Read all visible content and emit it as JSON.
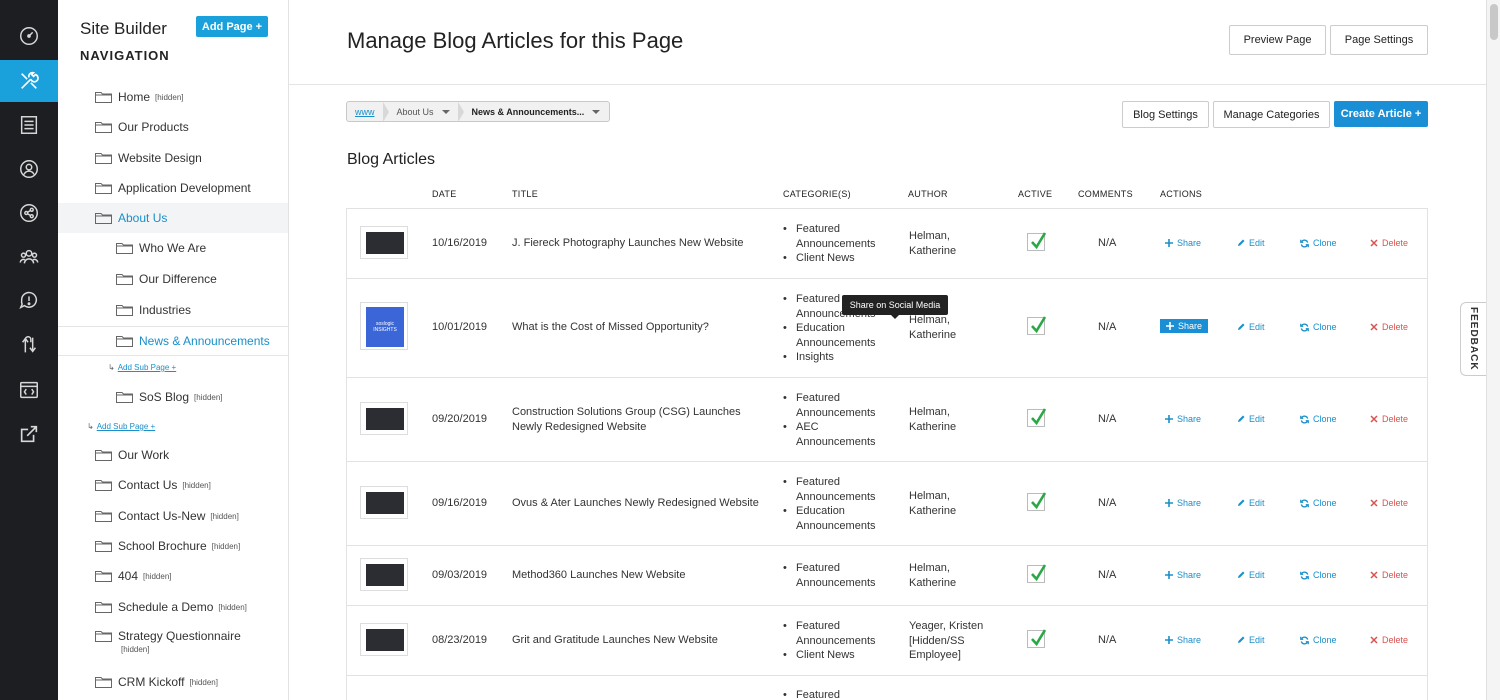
{
  "sidebar_icons": [
    {
      "name": "dashboard-icon"
    },
    {
      "name": "tools-icon",
      "active": true
    },
    {
      "name": "pages-icon"
    },
    {
      "name": "user-icon"
    },
    {
      "name": "share-icon"
    },
    {
      "name": "team-icon"
    },
    {
      "name": "alert-icon"
    },
    {
      "name": "arrows-icon"
    },
    {
      "name": "code-icon"
    },
    {
      "name": "external-link-icon"
    }
  ],
  "panel": {
    "title": "Site Builder",
    "subtitle": "NAVIGATION",
    "add_page_label": "Add Page +",
    "items": [
      {
        "label": "Home",
        "tag": "[hidden]"
      },
      {
        "label": "Our Products",
        "tag": ""
      },
      {
        "label": "Website Design",
        "tag": ""
      },
      {
        "label": "Application Development",
        "tag": ""
      },
      {
        "label": "About Us",
        "tag": ""
      },
      {
        "label": "Who We Are",
        "tag": ""
      },
      {
        "label": "Our Difference",
        "tag": ""
      },
      {
        "label": "Industries",
        "tag": ""
      },
      {
        "label": "News & Announcements",
        "tag": ""
      },
      {
        "label": "SoS Blog",
        "tag": "[hidden]"
      },
      {
        "label": "Our Work",
        "tag": ""
      },
      {
        "label": "Contact Us",
        "tag": "[hidden]"
      },
      {
        "label": "Contact Us-New",
        "tag": "[hidden]"
      },
      {
        "label": "School Brochure",
        "tag": "[hidden]"
      },
      {
        "label": "404",
        "tag": "[hidden]"
      },
      {
        "label": "Schedule a Demo",
        "tag": "[hidden]"
      },
      {
        "label": "Strategy Questionnaire",
        "tag": "[hidden]"
      },
      {
        "label": "CRM Kickoff",
        "tag": "[hidden]"
      }
    ],
    "add_sub_page_label": "Add Sub Page +"
  },
  "header": {
    "title": "Manage Blog Articles for this Page",
    "preview_label": "Preview Page",
    "settings_label": "Page Settings"
  },
  "breadcrumb": {
    "root": "www",
    "level1": "About Us",
    "level2": "News & Announcements..."
  },
  "toolbar": {
    "blog_settings": "Blog Settings",
    "manage_categories": "Manage Categories",
    "create_article": "Create Article +"
  },
  "section_title": "Blog Articles",
  "columns": {
    "date": "DATE",
    "title": "TITLE",
    "categories": "CATEGORIE(S)",
    "author": "AUTHOR",
    "active": "ACTIVE",
    "comments": "COMMENTS",
    "actions": "ACTIONS"
  },
  "actions": {
    "share": "Share",
    "edit": "Edit",
    "clone": "Clone",
    "delete": "Delete"
  },
  "tooltip": "Share on Social Media",
  "articles": [
    {
      "date": "10/16/2019",
      "title": "J. Fiereck Photography Launches New Website",
      "categories": [
        "Featured Announcements",
        "Client News"
      ],
      "author": "Helman, Katherine",
      "active": true,
      "comments": "N/A"
    },
    {
      "date": "10/01/2019",
      "title": "What is the Cost of Missed Opportunity?",
      "categories": [
        "Featured Announcements",
        "Education Announcements",
        "Insights"
      ],
      "author": "Helman, Katherine",
      "active": true,
      "comments": "N/A",
      "thumb_text": "soslogic INSIGHTS"
    },
    {
      "date": "09/20/2019",
      "title": "Construction Solutions Group (CSG) Launches Newly Redesigned Website",
      "categories": [
        "Featured Announcements",
        "AEC Announcements"
      ],
      "author": "Helman, Katherine",
      "active": true,
      "comments": "N/A"
    },
    {
      "date": "09/16/2019",
      "title": "Ovus & Ater Launches Newly Redesigned Website",
      "categories": [
        "Featured Announcements",
        "Education Announcements"
      ],
      "author": "Helman, Katherine",
      "active": true,
      "comments": "N/A"
    },
    {
      "date": "09/03/2019",
      "title": "Method360 Launches New Website",
      "categories": [
        "Featured Announcements"
      ],
      "author": "Helman, Katherine",
      "active": true,
      "comments": "N/A"
    },
    {
      "date": "08/23/2019",
      "title": "Grit and Gratitude Launches New Website",
      "categories": [
        "Featured Announcements",
        "Client News"
      ],
      "author": "Yeager, Kristen [Hidden/SS Employee]",
      "active": true,
      "comments": "N/A"
    },
    {
      "date": "",
      "title": "",
      "categories": [
        "Featured"
      ],
      "author": "",
      "active": false,
      "comments": ""
    }
  ],
  "feedback_label": "FEEDBACK"
}
